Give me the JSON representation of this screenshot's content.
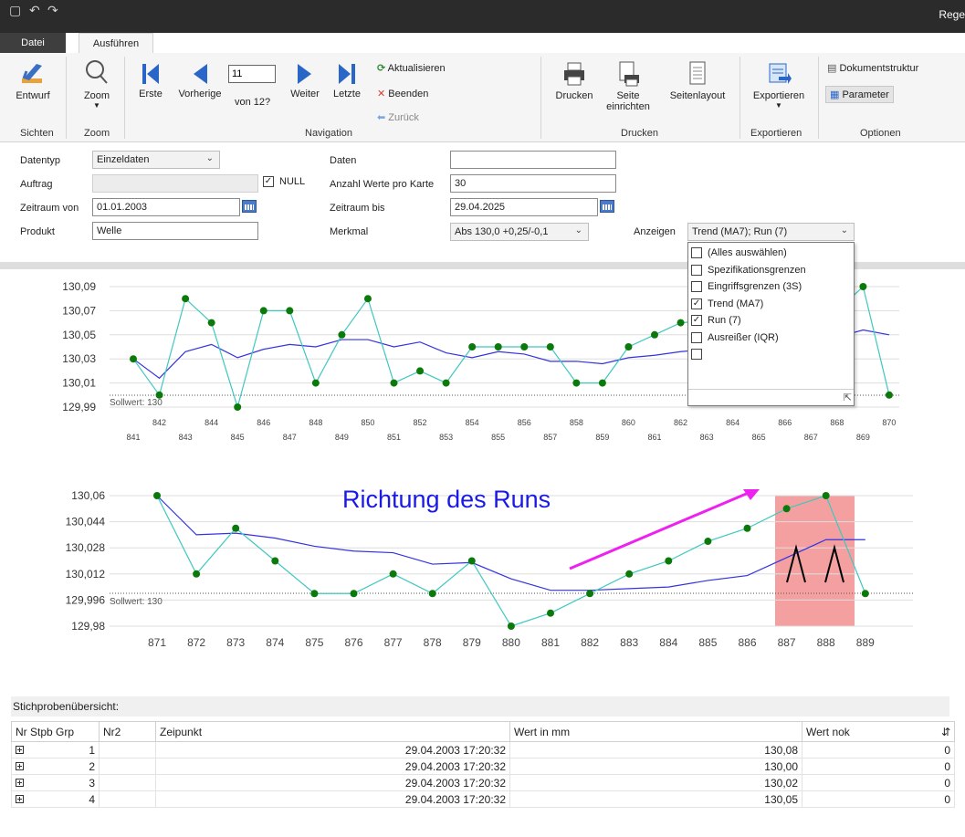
{
  "titlebar": {
    "save_icon": "save-icon",
    "undo_icon": "undo-icon",
    "redo_icon": "redo-icon",
    "app_title": "Rege"
  },
  "menu": {
    "tab_file": "Datei",
    "tab_run": "Ausführen"
  },
  "ribbon": {
    "sichten": {
      "design_label": "Entwurf",
      "group": "Sichten"
    },
    "zoom": {
      "zoom_label": "Zoom",
      "group": "Zoom"
    },
    "navigation": {
      "first": "Erste",
      "previous": "Vorherige",
      "page_value": "11",
      "page_of": "von 12?",
      "next": "Weiter",
      "last": "Letzte",
      "refresh": "Aktualisieren",
      "stop": "Beenden",
      "back": "Zurück",
      "group": "Navigation"
    },
    "drucken": {
      "print": "Drucken",
      "page_setup_1": "Seite",
      "page_setup_2": "einrichten",
      "layout": "Seitenlayout",
      "group": "Drucken"
    },
    "exportieren": {
      "export": "Exportieren",
      "group": "Exportieren"
    },
    "optionen": {
      "doc_structure": "Dokumentstruktur",
      "parameter": "Parameter",
      "group": "Optionen"
    }
  },
  "form": {
    "datentyp_label": "Datentyp",
    "datentyp_value": "Einzeldaten",
    "auftrag_label": "Auftrag",
    "null_label": "NULL",
    "null_checked": true,
    "zeitraum_von_label": "Zeitraum von",
    "zeitraum_von_value": "01.01.2003",
    "produkt_label": "Produkt",
    "produkt_value": "Welle",
    "daten_label": "Daten",
    "daten_value": "",
    "anzahl_label": "Anzahl Werte pro Karte",
    "anzahl_value": "30",
    "zeitraum_bis_label": "Zeitraum bis",
    "zeitraum_bis_value": "29.04.2025",
    "merkmal_label": "Merkmal",
    "merkmal_value": "Abs 130,0 +0,25/-0,1",
    "anzeigen_label": "Anzeigen",
    "anzeigen_value": "Trend (MA7); Run (7)"
  },
  "dropdown_options": [
    {
      "label": "(Alles auswählen)",
      "checked": false
    },
    {
      "label": "Spezifikationsgrenzen",
      "checked": false
    },
    {
      "label": "Eingriffsgrenzen (3S)",
      "checked": false
    },
    {
      "label": "Trend (MA7)",
      "checked": true
    },
    {
      "label": "Run (7)",
      "checked": true
    },
    {
      "label": "Ausreißer (IQR)",
      "checked": false
    },
    {
      "label": "",
      "checked": false
    }
  ],
  "chart_data": [
    {
      "type": "line",
      "sollwert_label": "Sollwert: 130",
      "x": [
        841,
        842,
        843,
        844,
        845,
        846,
        847,
        848,
        849,
        850,
        851,
        852,
        853,
        854,
        855,
        856,
        857,
        858,
        859,
        860,
        861,
        862,
        868,
        869,
        870
      ],
      "series": [
        {
          "values": [
            130.03,
            130.0,
            130.08,
            130.06,
            129.99,
            130.07,
            130.07,
            130.01,
            130.05,
            130.08,
            130.01,
            130.02,
            130.01,
            130.04,
            130.04,
            130.04,
            130.04,
            130.01,
            130.01,
            130.04,
            130.05,
            130.06,
            130.07,
            130.09,
            130.0
          ]
        }
      ],
      "trend": {
        "x": [
          841,
          842,
          843,
          844,
          845,
          846,
          847,
          848,
          849,
          850,
          851,
          852,
          853,
          854,
          855,
          856,
          857,
          858,
          859,
          860,
          861,
          862,
          868,
          869,
          870
        ],
        "values": [
          130.03,
          130.014,
          130.036,
          130.042,
          130.031,
          130.038,
          130.042,
          130.04,
          130.046,
          130.046,
          130.04,
          130.044,
          130.035,
          130.031,
          130.036,
          130.034,
          130.028,
          130.028,
          130.026,
          130.031,
          130.033,
          130.036,
          130.048,
          130.054,
          130.05
        ]
      },
      "ylim": [
        129.99,
        130.09
      ],
      "yticks": [
        "130,09",
        "130,07",
        "130,05",
        "130,03",
        "130,01",
        "129,99"
      ],
      "xticks_even": [
        "842",
        "844",
        "846",
        "848",
        "850",
        "852",
        "854",
        "856",
        "858",
        "860",
        "862",
        "864",
        "866",
        "868",
        "870"
      ],
      "xticks_odd": [
        "841",
        "843",
        "845",
        "847",
        "849",
        "851",
        "853",
        "855",
        "857",
        "859",
        "861",
        "863",
        "865",
        "867",
        "869"
      ],
      "colors": {
        "line": "#3ec8c0",
        "marker": "#0b7a0b",
        "trend": "#3333e0",
        "grid": "#dddddd"
      }
    },
    {
      "type": "line",
      "sollwert_label": "Sollwert: 130",
      "annotation": "Richtung des Runs",
      "x": [
        871,
        872,
        873,
        874,
        875,
        876,
        877,
        878,
        879,
        880,
        881,
        882,
        883,
        884,
        885,
        886,
        887,
        888,
        889
      ],
      "series": [
        {
          "values": [
            130.06,
            130.012,
            130.04,
            130.02,
            130.0,
            130.0,
            130.012,
            130.0,
            130.02,
            129.98,
            129.988,
            130.0,
            130.012,
            130.02,
            130.032,
            130.04,
            130.052,
            130.06,
            130.0
          ]
        }
      ],
      "trend": {
        "x": [
          871,
          872,
          873,
          874,
          875,
          876,
          877,
          878,
          879,
          880,
          881,
          882,
          883,
          884,
          885,
          886,
          887,
          888,
          889
        ],
        "values": [
          130.06,
          130.036,
          130.037,
          130.034,
          130.029,
          130.026,
          130.025,
          130.018,
          130.019,
          130.009,
          130.002,
          130.002,
          130.003,
          130.004,
          130.008,
          130.011,
          130.022,
          130.033,
          130.033
        ]
      },
      "ylim": [
        129.98,
        130.06
      ],
      "yticks": [
        "130,06",
        "130,044",
        "130,028",
        "130,012",
        "129,996",
        "129,98"
      ],
      "xticks": [
        "871",
        "872",
        "873",
        "874",
        "875",
        "876",
        "877",
        "878",
        "879",
        "880",
        "881",
        "882",
        "883",
        "884",
        "885",
        "886",
        "887",
        "888",
        "889"
      ],
      "colors": {
        "line": "#3ec8c0",
        "marker": "#0b7a0b",
        "trend": "#3333e0",
        "arrow": "#ee22ee",
        "highlight": "#f4a0a0",
        "annotation": "#1a1ae6"
      }
    }
  ],
  "table": {
    "title": "Stichprobenübersicht:",
    "columns": [
      "Nr Stpb Grp",
      "Nr2",
      "Zeipunkt",
      "Wert in mm",
      "Wert nok"
    ],
    "rows": [
      [
        "1",
        "",
        "29.04.2003 17:20:32",
        "130,08",
        "0"
      ],
      [
        "2",
        "",
        "29.04.2003 17:20:32",
        "130,00",
        "0"
      ],
      [
        "3",
        "",
        "29.04.2003 17:20:32",
        "130,02",
        "0"
      ],
      [
        "4",
        "",
        "29.04.2003 17:20:32",
        "130,05",
        "0"
      ]
    ]
  }
}
